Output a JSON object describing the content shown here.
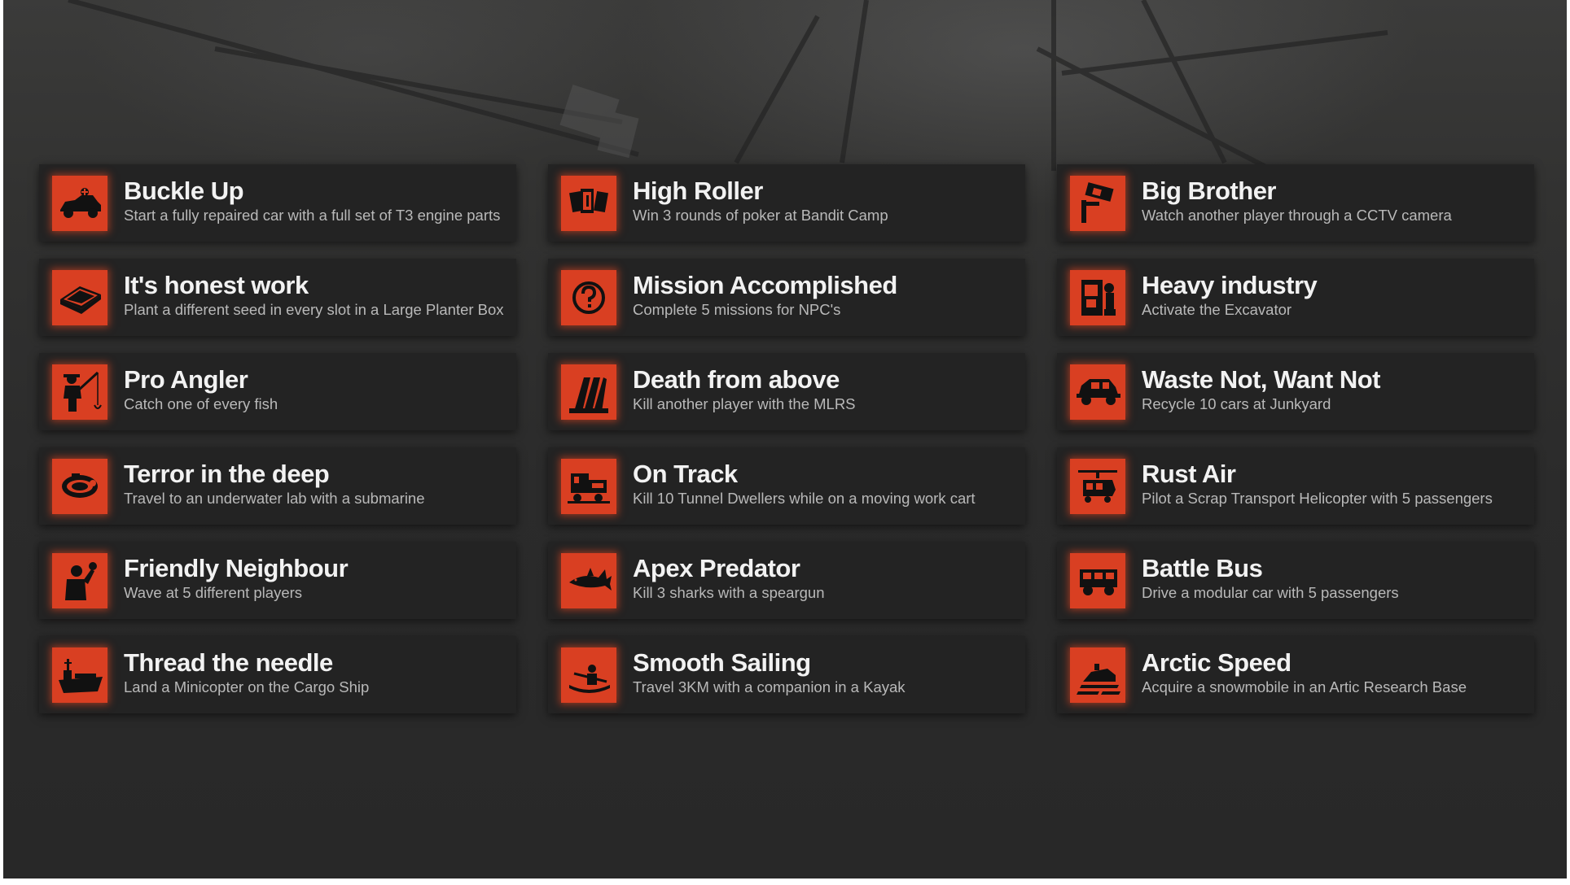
{
  "achievements": [
    {
      "icon": "car-icon",
      "title": "Buckle Up",
      "description": "Start a fully repaired car with a full set of T3 engine parts"
    },
    {
      "icon": "playing-cards-icon",
      "title": "High Roller",
      "description": "Win 3 rounds of poker at Bandit Camp"
    },
    {
      "icon": "cctv-camera-icon",
      "title": "Big Brother",
      "description": "Watch another player through a CCTV camera"
    },
    {
      "icon": "planter-box-icon",
      "title": "It's honest work",
      "description": "Plant a different seed in every slot in a Large Planter Box"
    },
    {
      "icon": "question-mark-icon",
      "title": "Mission Accomplished",
      "description": "Complete 5 missions for NPC's"
    },
    {
      "icon": "excavator-icon",
      "title": "Heavy industry",
      "description": "Activate the Excavator"
    },
    {
      "icon": "fisherman-icon",
      "title": "Pro Angler",
      "description": "Catch one of every fish"
    },
    {
      "icon": "mlrs-rockets-icon",
      "title": "Death from above",
      "description": "Kill another player with the MLRS"
    },
    {
      "icon": "wrecked-car-icon",
      "title": "Waste Not, Want Not",
      "description": "Recycle 10 cars at Junkyard"
    },
    {
      "icon": "submarine-icon",
      "title": "Terror in the deep",
      "description": "Travel to an underwater lab with a submarine"
    },
    {
      "icon": "work-cart-icon",
      "title": "On Track",
      "description": "Kill 10 Tunnel Dwellers while on a moving work cart"
    },
    {
      "icon": "helicopter-icon",
      "title": "Rust Air",
      "description": "Pilot a Scrap Transport Helicopter with 5 passengers"
    },
    {
      "icon": "waving-player-icon",
      "title": "Friendly Neighbour",
      "description": "Wave at 5 different players"
    },
    {
      "icon": "shark-icon",
      "title": "Apex Predator",
      "description": "Kill 3 sharks with a speargun"
    },
    {
      "icon": "modular-car-icon",
      "title": "Battle Bus",
      "description": "Drive a modular car with 5 passengers"
    },
    {
      "icon": "cargo-ship-icon",
      "title": "Thread the needle",
      "description": "Land a Minicopter on the Cargo Ship"
    },
    {
      "icon": "kayak-icon",
      "title": "Smooth Sailing",
      "description": "Travel 3KM with a companion in a Kayak"
    },
    {
      "icon": "snowmobile-icon",
      "title": "Arctic Speed",
      "description": "Acquire a snowmobile in an Artic Research Base"
    }
  ],
  "colors": {
    "icon_background": "#d93f22",
    "card_background": "#232323",
    "title_text": "#f2f2f2",
    "description_text": "#b9b9b9"
  }
}
